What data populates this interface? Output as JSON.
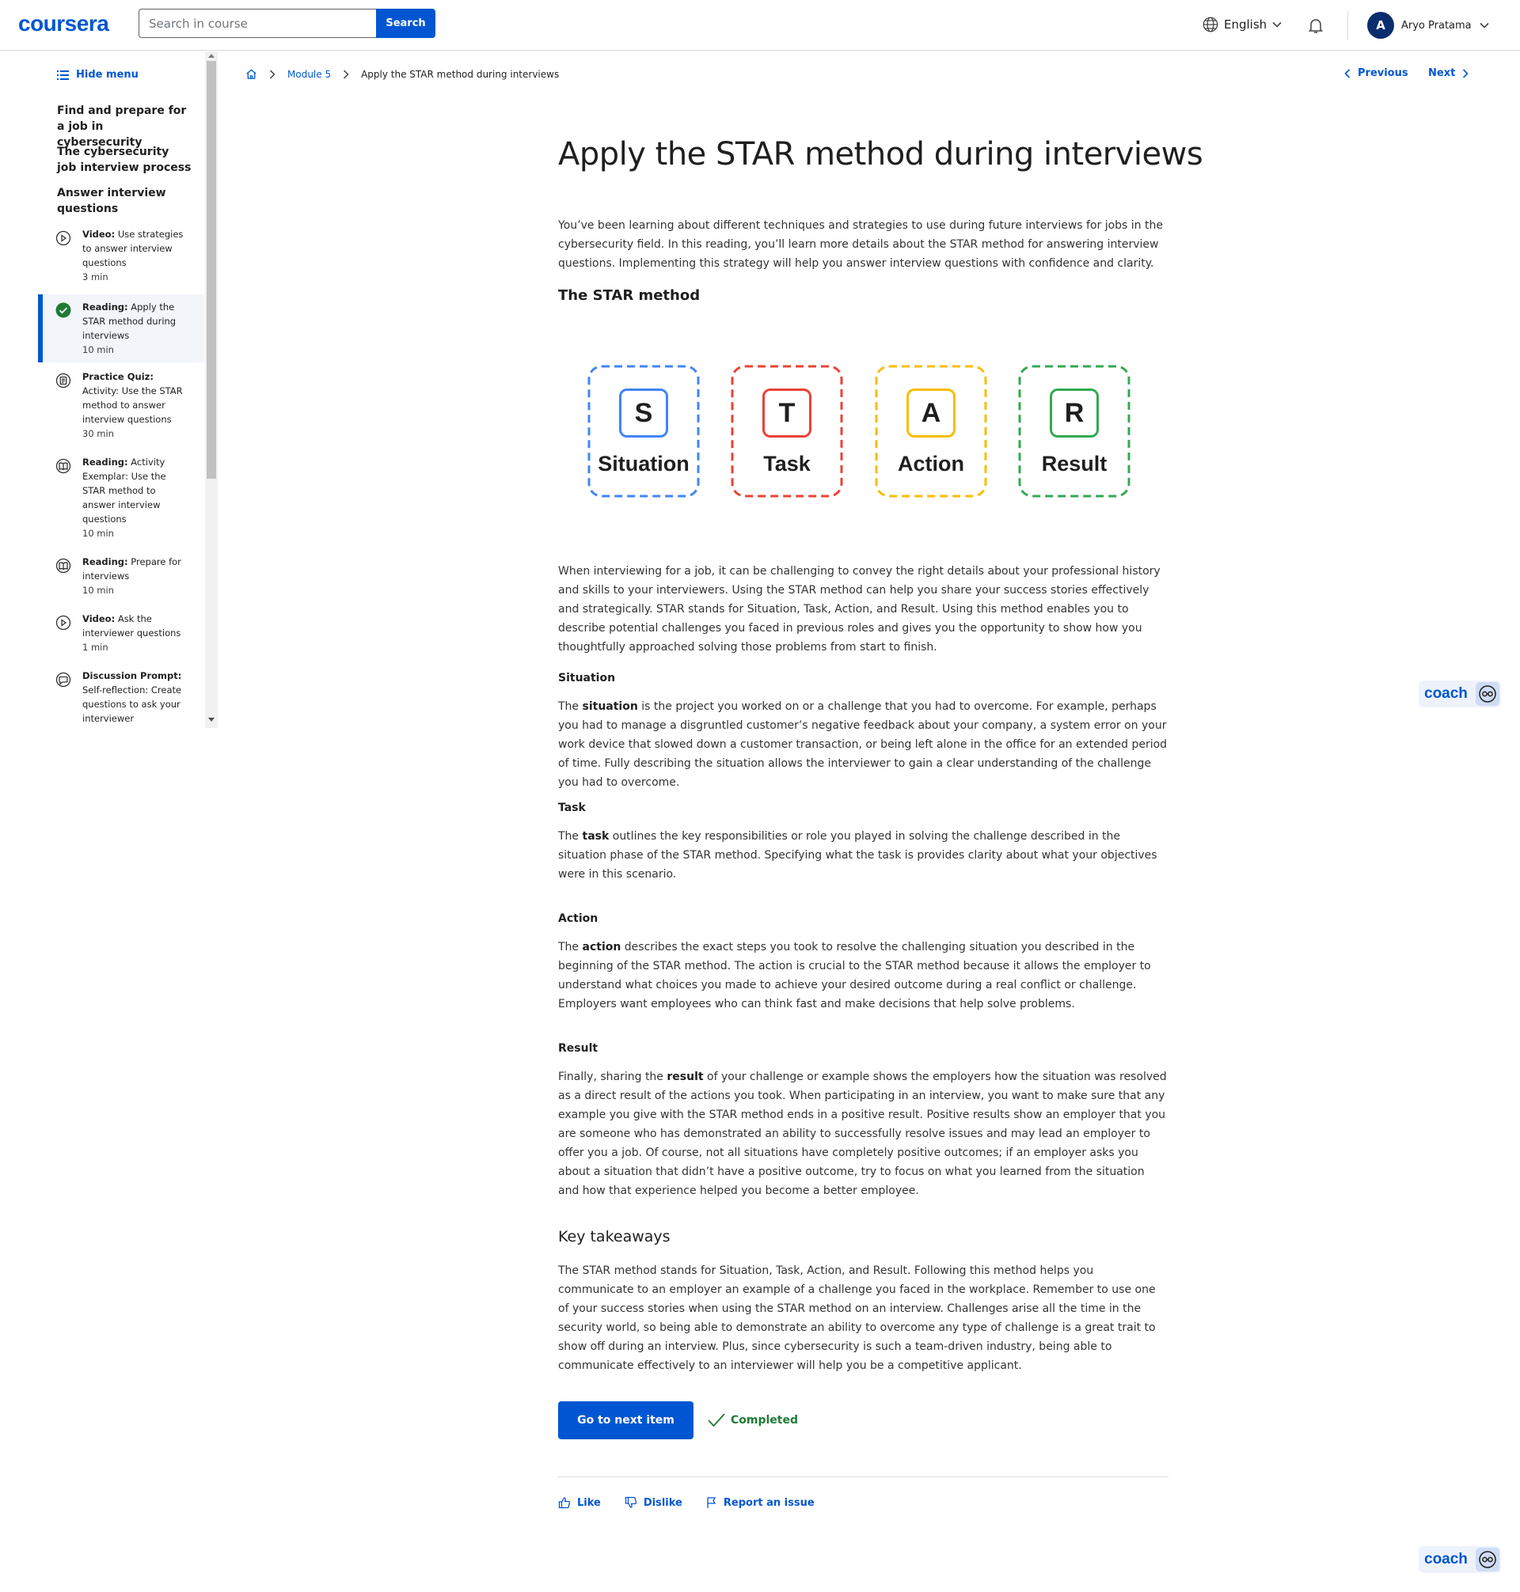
{
  "header": {
    "logo": "coursera",
    "search_placeholder": "Search in course",
    "search_button": "Search",
    "language": "English",
    "user_initial": "A",
    "user_name": "Aryo Pratama"
  },
  "sidebar": {
    "hide_menu": "Hide menu",
    "sections": [
      "Find and prepare for a job in cybersecurity",
      "The cybersecurity job interview process",
      "Answer interview questions"
    ],
    "items": [
      {
        "type": "Video:",
        "title": "Use strategies to answer interview questions",
        "duration": "3 min",
        "icon": "play-icon"
      },
      {
        "type": "Reading:",
        "title": "Apply the STAR method during interviews",
        "duration": "10 min",
        "icon": "completed-check-icon"
      },
      {
        "type": "Practice Quiz:",
        "title": "Activity: Use the STAR method to answer interview questions",
        "duration": "30 min",
        "icon": "quiz-icon"
      },
      {
        "type": "Reading:",
        "title": "Activity Exemplar: Use the STAR method to answer interview questions",
        "duration": "10 min",
        "icon": "reading-icon"
      },
      {
        "type": "Reading:",
        "title": "Prepare for interviews",
        "duration": "10 min",
        "icon": "reading-icon"
      },
      {
        "type": "Video:",
        "title": "Ask the interviewer questions",
        "duration": "1 min",
        "icon": "play-icon"
      },
      {
        "type": "Discussion Prompt:",
        "title": "Self-reflection: Create questions to ask your interviewer",
        "duration": "",
        "icon": "discussion-icon"
      }
    ]
  },
  "breadcrumb": {
    "module": "Module 5",
    "current": "Apply the STAR method during interviews"
  },
  "nav": {
    "previous": "Previous",
    "next": "Next"
  },
  "content": {
    "title": "Apply the STAR method during interviews",
    "intro": "You’ve been learning about different techniques and strategies to use during future interviews for jobs in the cybersecurity field. In this reading, you’ll learn more details about the STAR method for answering interview questions. Implementing this strategy will help you answer interview questions with confidence and clarity.",
    "star_heading": "The STAR method",
    "star_cards": [
      {
        "letter": "S",
        "word": "Situation",
        "color": "#4285f4"
      },
      {
        "letter": "T",
        "word": "Task",
        "color": "#ea4335"
      },
      {
        "letter": "A",
        "word": "Action",
        "color": "#fbbc04"
      },
      {
        "letter": "R",
        "word": "Result",
        "color": "#34a853"
      }
    ],
    "overview": "When interviewing for a job, it can be challenging to convey the right details about your professional history and skills to your interviewers. Using the STAR method can help you share your success stories effectively and strategically. STAR stands for Situation, Task, Action, and Result. Using this method enables you to describe potential challenges you faced in previous roles and gives you the opportunity to show how you thoughtfully approached solving those problems from start to finish.",
    "situation_heading": "Situation",
    "situation_pre": "The ",
    "situation_bold": "situation",
    "situation_post": " is the project you worked on or a challenge that you had to overcome. For example, perhaps you had to manage a disgruntled customer’s negative feedback about your company,  a system error on your work device that slowed down a customer transaction, or being left alone in the office for an extended period of time. Fully describing the situation allows the interviewer to gain a clear understanding of the challenge you had to overcome.",
    "task_heading": "Task",
    "task_pre": "The ",
    "task_bold": "task",
    "task_post": " outlines the key responsibilities or role you played in solving the challenge described in the situation phase of the STAR method. Specifying what the task is provides clarity about what your objectives were in this scenario.",
    "action_heading": "Action",
    "action_pre": "The ",
    "action_bold": "action",
    "action_post": " describes the exact steps you took to resolve the challenging situation you described in the beginning of the STAR method. The action is crucial to the STAR method because it allows the employer to understand what choices you made to achieve your desired outcome during a real conflict or challenge. Employers want employees who can think fast and make decisions that help solve problems.",
    "result_heading": "Result",
    "result_pre": "Finally, sharing the ",
    "result_bold": "result",
    "result_post": " of your challenge or example shows the employers how the situation was resolved as a direct result of the actions you took. When participating in an interview, you want to make sure that any example you give with the STAR method ends in a positive result. Positive results show an employer that you are someone who has demonstrated an ability to successfully resolve issues and may lead an employer to offer you a job. Of course, not all situations have completely positive outcomes; if an employer asks you about a situation that didn’t have a positive outcome, try to focus on what you learned from the situation and how that experience helped you become a better employee.",
    "takeaways_heading": "Key takeaways",
    "takeaways": "The STAR method stands for Situation, Task, Action, and Result. Following this method helps you communicate to an employer an example of a challenge you faced in the workplace. Remember to use one of your success stories when using the STAR method on an interview. Challenges arise all the time in the security world, so being able to demonstrate an ability to overcome any type of challenge is a great trait to show off during an interview. Plus, since cybersecurity is such a team-driven industry, being able to communicate effectively to an interviewer will help you be a competitive applicant."
  },
  "actions": {
    "next_item": "Go to next item",
    "completed": "Completed",
    "like": "Like",
    "dislike": "Dislike",
    "report": "Report an issue"
  },
  "coach": {
    "label": "coach"
  }
}
